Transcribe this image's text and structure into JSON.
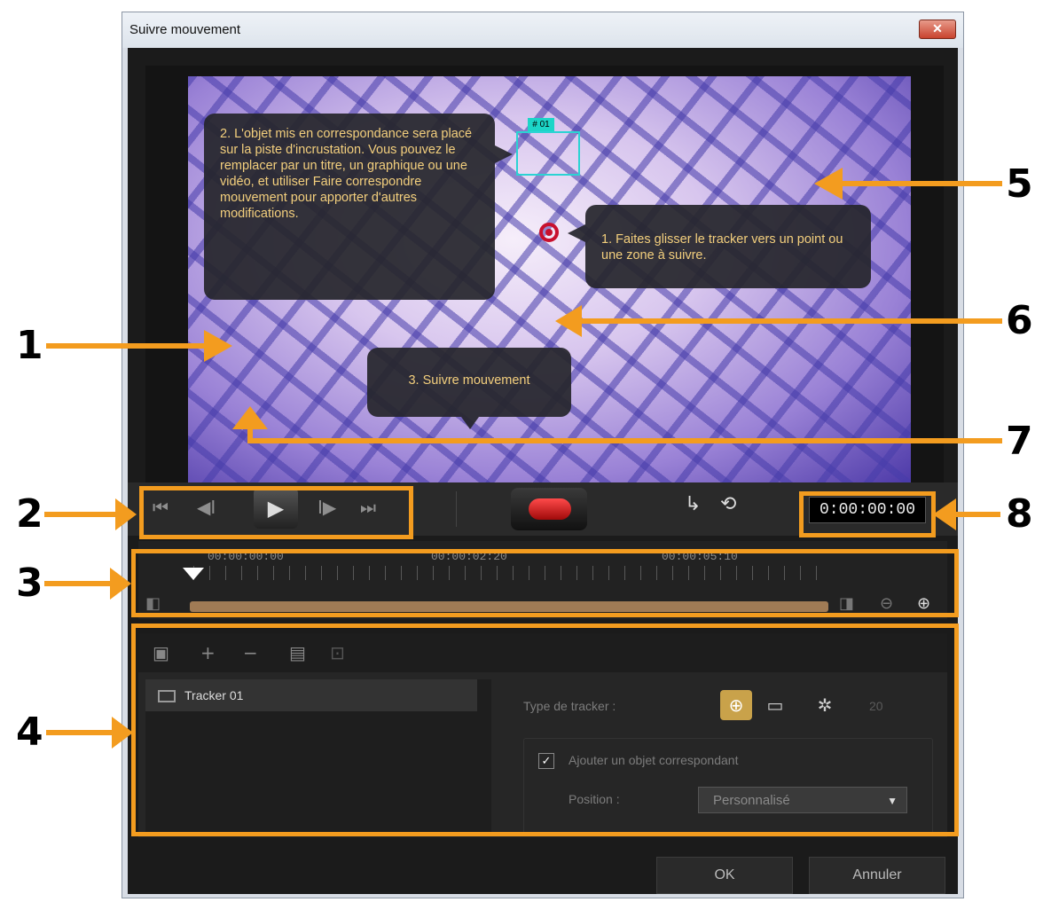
{
  "window": {
    "title": "Suivre mouvement",
    "close_glyph": "✕"
  },
  "video": {
    "bubble_1": "1. Faites glisser le tracker vers un point ou une zone à suivre.",
    "bubble_2": "2. L'objet mis en correspondance sera placé sur la piste d'incrustation. Vous pouvez le remplacer par un titre, un graphique ou une vidéo, et utiliser Faire correspondre mouvement pour apporter d'autres modifications.",
    "bubble_3": "3. Suivre mouvement",
    "tracker_label": "# 01"
  },
  "transport": {
    "first": "⏮",
    "prev": "◀Ι",
    "play": "▶",
    "next": "Ι▶",
    "last": "⏭",
    "timecode": "0:00:00:00"
  },
  "timeline": {
    "labels": [
      "00:00:00:00",
      "00:00:02:20",
      "00:00:05:10"
    ],
    "zoom_out": "⊖",
    "zoom_in": "⊕"
  },
  "panel": {
    "toolbar": {
      "add": "+",
      "remove": "−"
    },
    "tracker_item": "Tracker 01",
    "type_label": "Type de tracker :",
    "size_value": "20",
    "checkbox_label": "Ajouter un objet correspondant",
    "position_label": "Position :",
    "position_value": "Personnalisé"
  },
  "footer": {
    "ok": "OK",
    "cancel": "Annuler"
  },
  "annotations": [
    "1",
    "2",
    "3",
    "4",
    "5",
    "6",
    "7",
    "8"
  ],
  "colors": {
    "accent": "#f39c1f"
  }
}
